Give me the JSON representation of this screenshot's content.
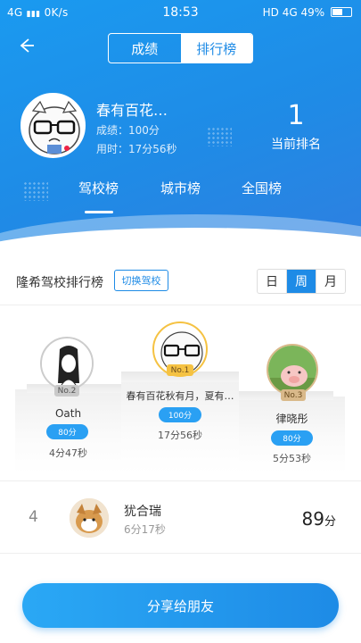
{
  "status_bar": {
    "network": "4G",
    "speed": "0K/s",
    "time": "18:53",
    "signal": "HD 4G",
    "battery": "49%"
  },
  "header": {
    "tab_scores": "成绩",
    "tab_ranking": "排行榜",
    "active_tab": "排行榜"
  },
  "profile": {
    "name": "春有百花…",
    "score_label": "成绩：",
    "score": "100分",
    "time_label": "用时：",
    "time": "17分56秒",
    "rank_value": "1",
    "rank_label": "当前排名"
  },
  "board_tabs": [
    "驾校榜",
    "城市榜",
    "全国榜"
  ],
  "active_board_tab": "驾校榜",
  "filter": {
    "title": "隆希驾校排行榜",
    "switch_button": "切换驾校",
    "periods": [
      "日",
      "周",
      "月"
    ],
    "active_period": "周"
  },
  "podium": [
    {
      "rank_badge": "No.2",
      "name": "Oath",
      "score": "80分",
      "time": "4分47秒"
    },
    {
      "rank_badge": "No.1",
      "name": "春有百花秋有月，夏有…",
      "score": "100分",
      "time": "17分56秒"
    },
    {
      "rank_badge": "No.3",
      "name": "律晓彤",
      "score": "80分",
      "time": "5分53秒"
    }
  ],
  "list": [
    {
      "rank": "4",
      "name": "犹合瑞",
      "time": "6分17秒",
      "score": "89",
      "unit": "分"
    }
  ],
  "share_button": "分享给朋友",
  "colors": {
    "primary": "#1e8be6",
    "gold": "#f5c242",
    "silver": "#c9c9c9",
    "bronze": "#d9b98a"
  }
}
